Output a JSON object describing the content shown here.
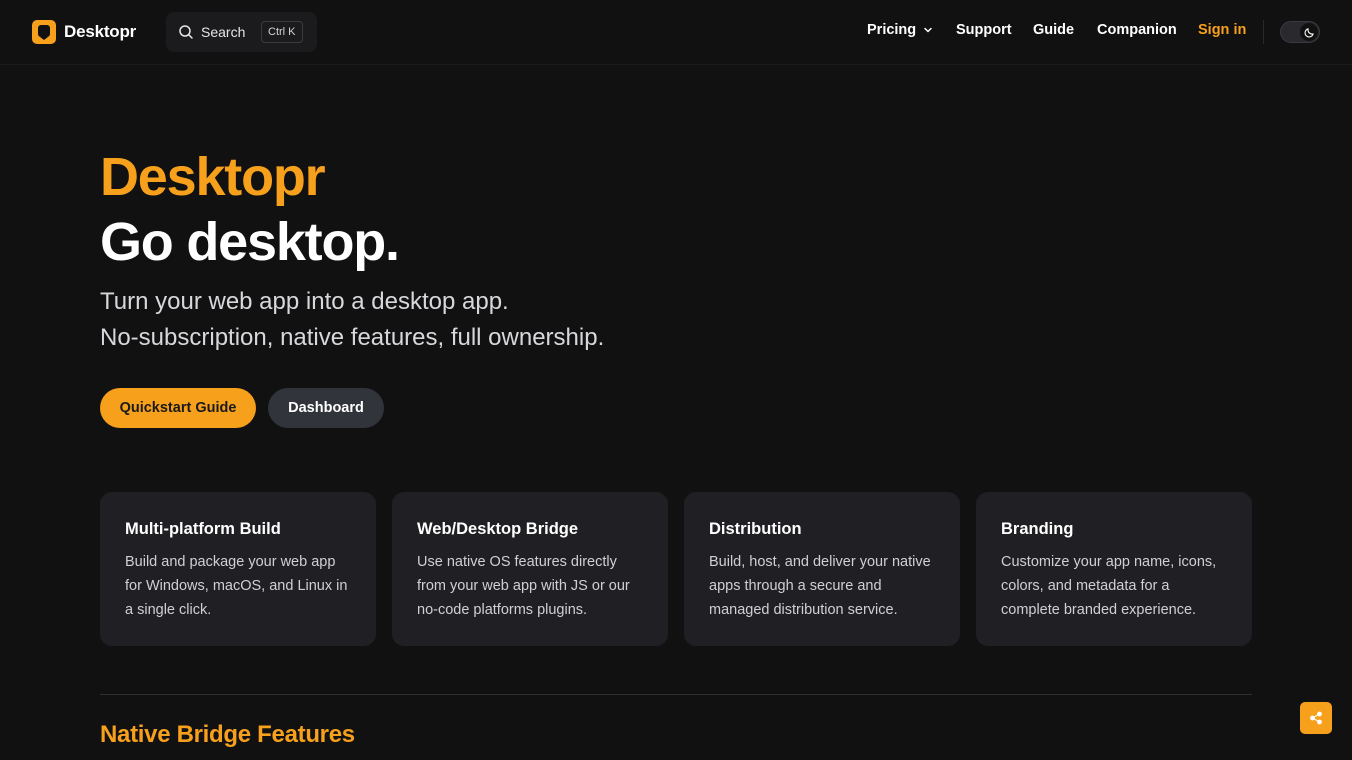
{
  "brand": {
    "name": "Desktopr",
    "accent": "#f7a01c",
    "logo_icon": "desktopr-logo-icon"
  },
  "search": {
    "label": "Search",
    "shortcut": "Ctrl K",
    "icon": "search-icon"
  },
  "nav": {
    "pricing": "Pricing",
    "support": "Support",
    "guide": "Guide",
    "companion": "Companion",
    "sign_in": "Sign in"
  },
  "theme_toggle": {
    "icon": "moon-icon"
  },
  "hero": {
    "brand": "Desktopr",
    "title": "Go desktop.",
    "subtitle_line1": "Turn your web app into a desktop app.",
    "subtitle_line2": "No-subscription, native features, full ownership.",
    "primary_cta": "Quickstart Guide",
    "secondary_cta": "Dashboard"
  },
  "features": [
    {
      "title": "Multi-platform Build",
      "description": "Build and package your web app for Windows, macOS, and Linux in a single click."
    },
    {
      "title": "Web/Desktop Bridge",
      "description": "Use native OS features directly from your web app with JS or our no-code platforms plugins."
    },
    {
      "title": "Distribution",
      "description": "Build, host, and deliver your native apps through a secure and managed distribution service."
    },
    {
      "title": "Branding",
      "description": "Customize your app name, icons, colors, and metadata for a complete branded experience."
    }
  ],
  "section": {
    "title": "Native Bridge Features"
  },
  "share": {
    "icon": "share-icon"
  }
}
